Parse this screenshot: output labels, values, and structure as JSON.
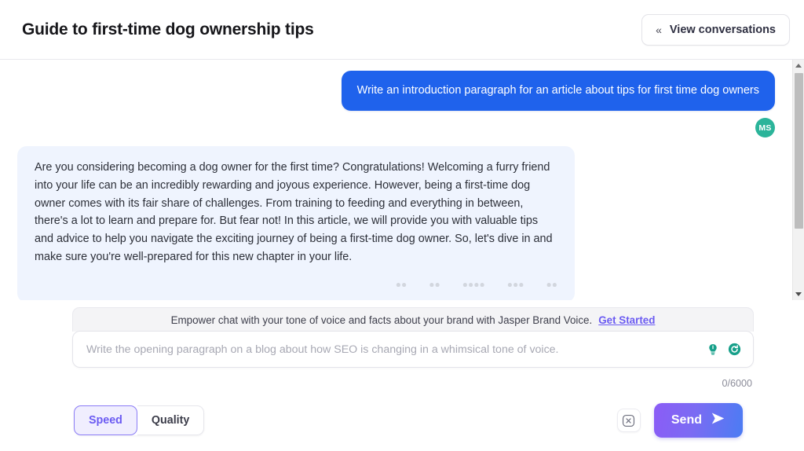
{
  "header": {
    "title": "Guide to first-time dog ownership tips",
    "view_conversations_label": "View conversations",
    "view_conversations_icon": "double-chevron-left-icon"
  },
  "chat": {
    "messages": [
      {
        "role": "user",
        "text": "Write an introduction paragraph for an article about tips for first time dog owners",
        "avatar_initials": "MS",
        "avatar_color": "#2bb49a"
      },
      {
        "role": "assistant",
        "text": "Are you considering becoming a dog owner for the first time? Congratulations! Welcoming a furry friend into your life can be an incredibly rewarding and joyous experience. However, being a first-time dog owner comes with its fair share of challenges. From training to feeding and everything in between, there's a lot to learn and prepare for. But fear not! In this article, we will provide you with valuable tips and advice to help you navigate the exciting journey of being a first-time dog owner. So, let's dive in and make sure you're well-prepared for this new chapter in your life."
      }
    ],
    "scrollbar": {
      "up_icon": "scroll-up-arrow-icon",
      "down_icon": "scroll-down-arrow-icon"
    }
  },
  "composer": {
    "banner_text": "Empower chat with your tone of voice and facts about your brand with Jasper Brand Voice.",
    "banner_cta": "Get Started",
    "input_value": "",
    "input_placeholder": "Write the opening paragraph on a blog about how SEO is changing in a whimsical tone of voice.",
    "idea_icon": "lightbulb-icon",
    "refresh_icon": "refresh-circle-icon",
    "counter": "0/6000"
  },
  "bottom": {
    "mode_options": [
      "Speed",
      "Quality"
    ],
    "mode_selected": "Speed",
    "stop_icon": "close-square-icon",
    "send_label": "Send",
    "send_icon": "paper-plane-icon"
  },
  "colors": {
    "user_bubble": "#1f62ec",
    "bot_bubble": "#eff4fe",
    "accent_purple": "#6b5bf2",
    "accent_teal": "#2bb49a"
  }
}
